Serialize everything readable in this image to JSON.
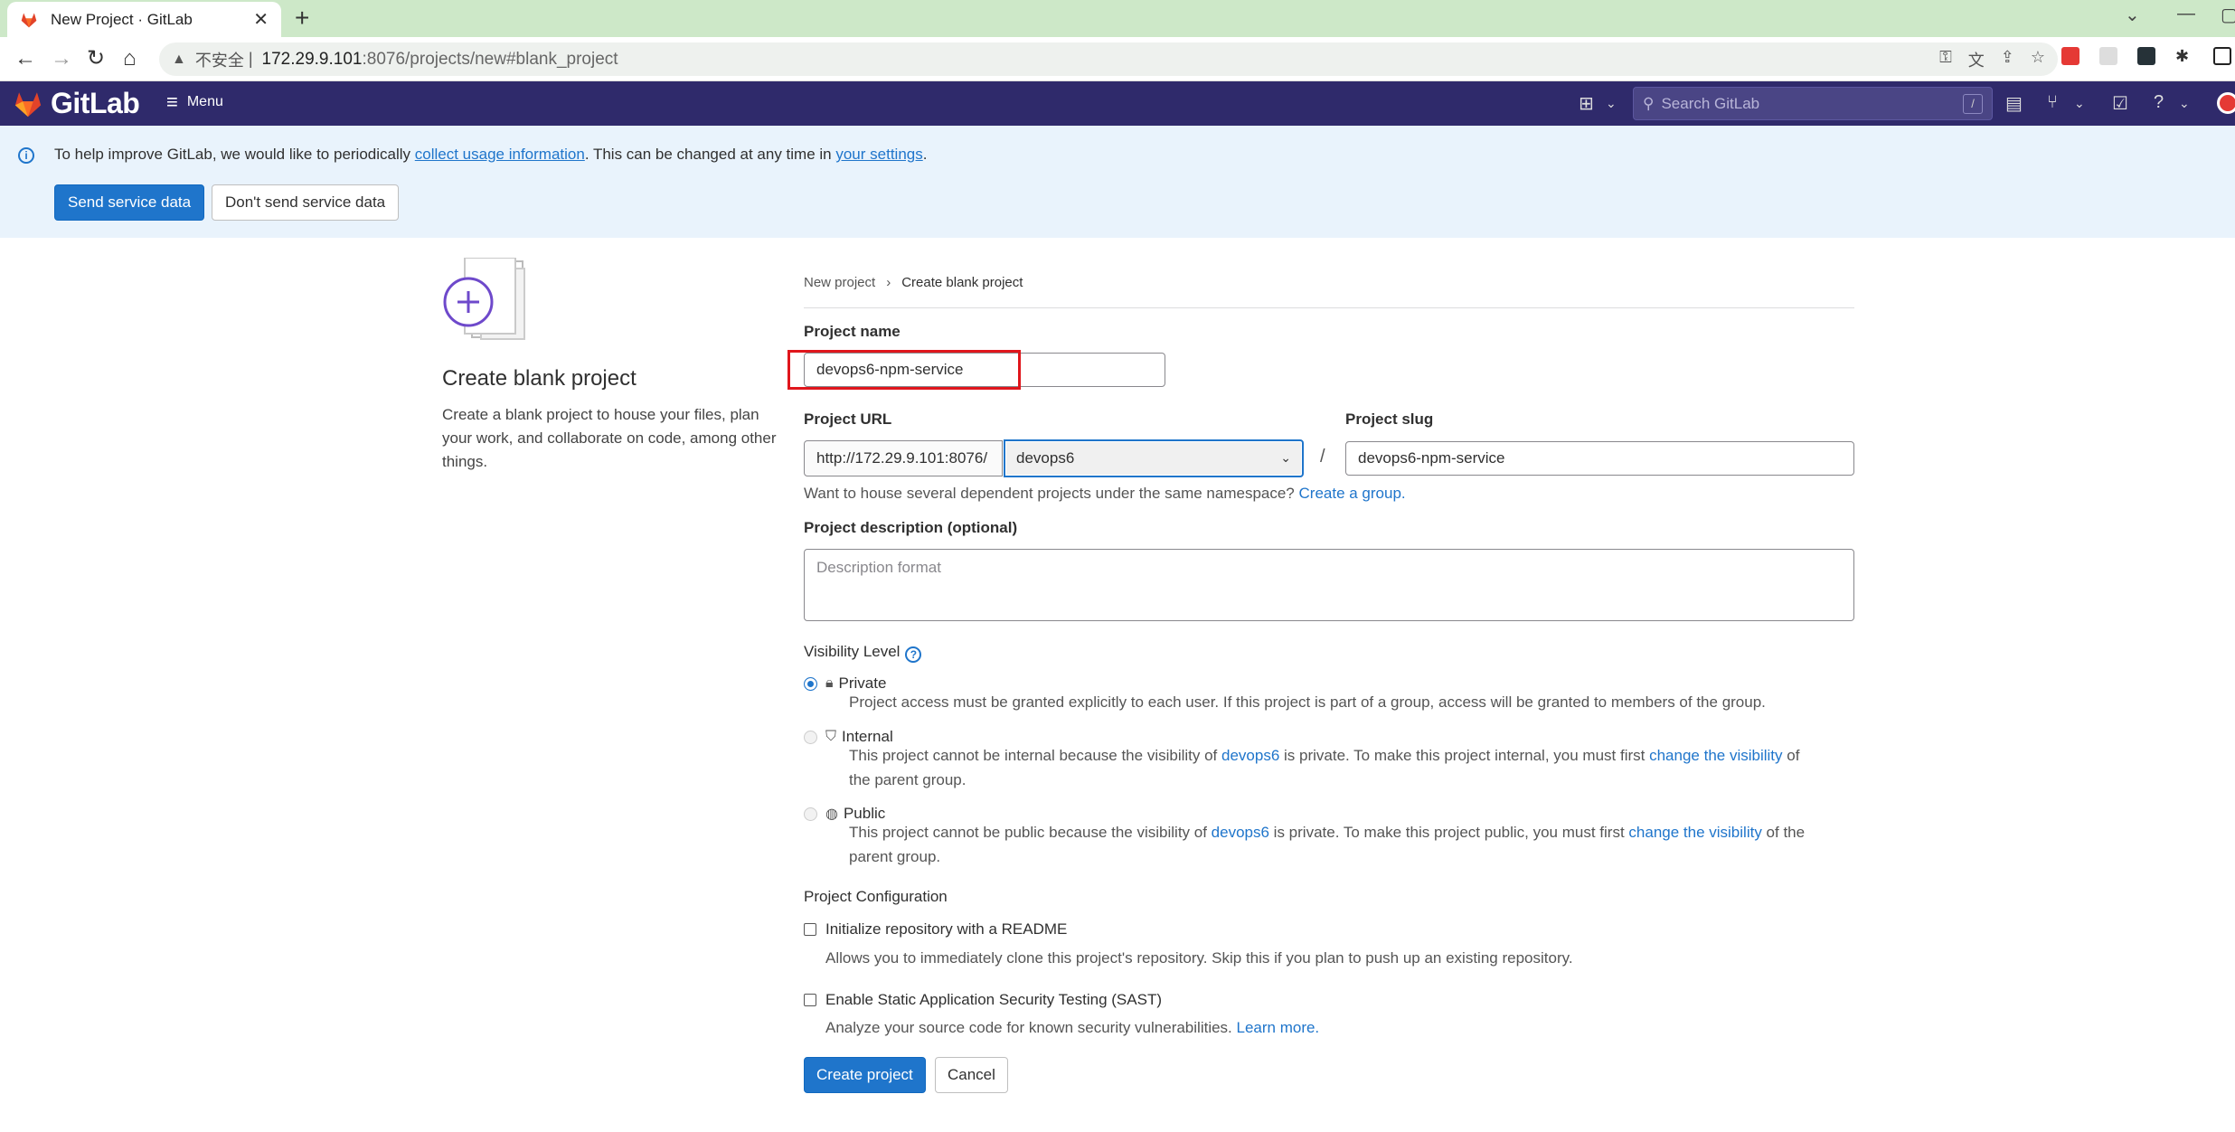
{
  "browser": {
    "tab_title": "New Project · GitLab",
    "insecure_label": "不安全",
    "url_host": "172.29.9.101",
    "url_rest": ":8076/projects/new#blank_project"
  },
  "header": {
    "logo_text": "GitLab",
    "menu_label": "Menu",
    "search_placeholder": "Search GitLab",
    "search_shortcut": "/"
  },
  "banner": {
    "text_before": "To help improve GitLab, we would like to periodically ",
    "link1": "collect usage information",
    "text_middle": ". This can be changed at any time in ",
    "link2": "your settings",
    "text_after": ".",
    "send_button": "Send service data",
    "dont_send_button": "Don't send service data"
  },
  "left": {
    "title": "Create blank project",
    "description": "Create a blank project to house your files, plan your work, and collaborate on code, among other things."
  },
  "breadcrumb": {
    "parent": "New project",
    "separator": "›",
    "current": "Create blank project"
  },
  "form": {
    "project_name_label": "Project name",
    "project_name_value": "devops6-npm-service",
    "project_url_label": "Project URL",
    "url_prefix": "http://172.29.9.101:8076/",
    "namespace_value": "devops6",
    "slash": "/",
    "project_slug_label": "Project slug",
    "project_slug_value": "devops6-npm-service",
    "namespace_help": "Want to house several dependent projects under the same namespace? ",
    "namespace_help_link": "Create a group.",
    "description_label": "Project description (optional)",
    "description_placeholder": "Description format",
    "visibility_label": "Visibility Level",
    "visibility": [
      {
        "title": "Private",
        "icon": "lock-icon",
        "selected": true,
        "desc": "Project access must be granted explicitly to each user. If this project is part of a group, access will be granted to members of the group."
      },
      {
        "title": "Internal",
        "icon": "shield-icon",
        "selected": false,
        "desc_a": "This project cannot be internal because the visibility of ",
        "desc_link1": "devops6",
        "desc_b": " is private. To make this project internal, you must first ",
        "desc_link2": "change the visibility",
        "desc_c": " of",
        "desc_line2": "the parent group."
      },
      {
        "title": "Public",
        "icon": "globe-icon",
        "selected": false,
        "desc_a": "This project cannot be public because the visibility of ",
        "desc_link1": "devops6",
        "desc_b": " is private. To make this project public, you must first ",
        "desc_link2": "change the visibility",
        "desc_c": " of the",
        "desc_line2": "parent group."
      }
    ],
    "config_label": "Project Configuration",
    "readme_label": "Initialize repository with a README",
    "readme_help": "Allows you to immediately clone this project's repository. Skip this if you plan to push up an existing repository.",
    "sast_label": "Enable Static Application Security Testing (SAST)",
    "sast_help": "Analyze your source code for known security vulnerabilities. ",
    "sast_link": "Learn more.",
    "create_button": "Create project",
    "cancel_button": "Cancel"
  }
}
